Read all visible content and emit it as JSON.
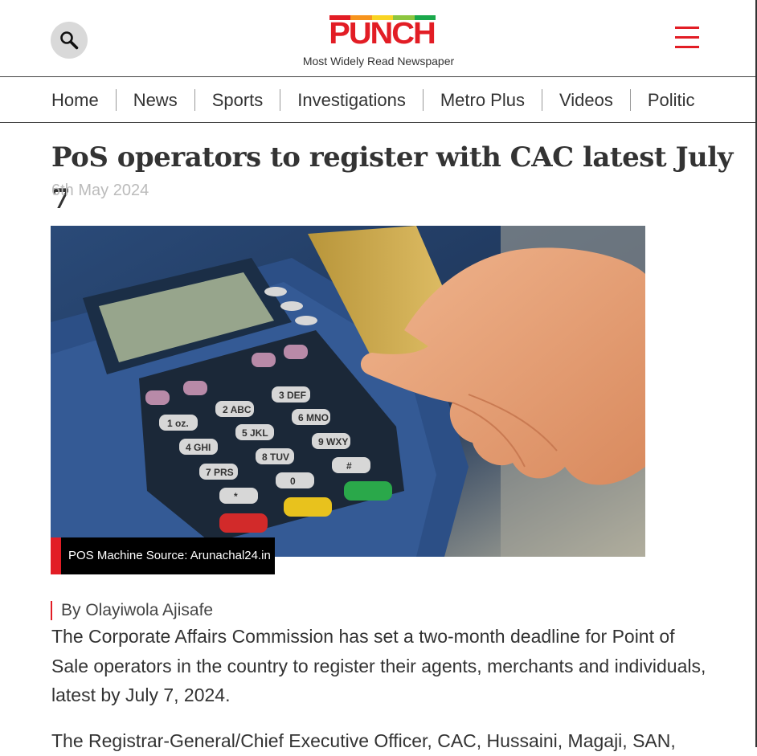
{
  "header": {
    "logo_text": "PUNCH",
    "logo_stripe_colors": [
      "#e21d25",
      "#f7941d",
      "#f9d423",
      "#8dc63f",
      "#1aa84b"
    ],
    "tagline": "Most Widely Read Newspaper",
    "search_icon": "search-icon",
    "menu_icon": "hamburger-menu-icon",
    "accent_color": "#e21d25"
  },
  "nav": {
    "items": [
      "Home",
      "News",
      "Sports",
      "Investigations",
      "Metro Plus",
      "Videos",
      "Politic"
    ]
  },
  "article": {
    "title": "PoS operators to register with CAC latest July 7",
    "date": "6th May 2024",
    "image_caption": "POS Machine Source: Arunachal24.in",
    "byline": "By Olayiwola Ajisafe",
    "paragraphs": [
      "The Corporate Affairs Commission has set a two-month deadline for Point of Sale operators in the country to register their agents, merchants and individuals, latest by July 7, 2024.",
      "The Registrar-General/Chief Executive Officer, CAC, Hussaini, Magaji, SAN,"
    ]
  },
  "keypad": {
    "keys": [
      "1 oz.",
      "2 ABC",
      "3 DEF",
      "4 GHI",
      "5 JKL",
      "6 MNO",
      "7 PRS",
      "8 TUV",
      "9 WXY",
      "*",
      "0",
      "#"
    ]
  }
}
